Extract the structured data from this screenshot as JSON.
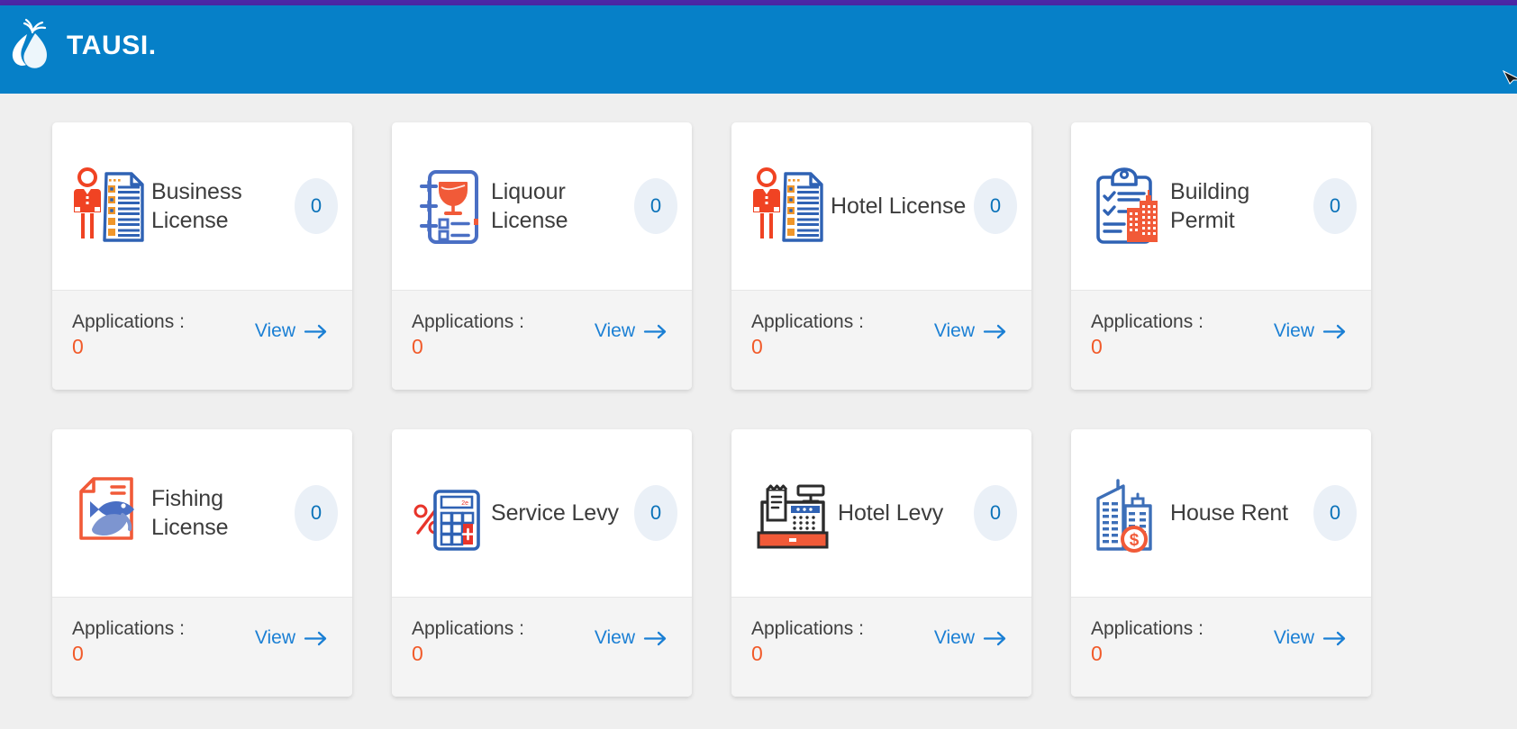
{
  "theme": {
    "accent_strip_color": "#4c27a6",
    "header_color": "#0680c8",
    "page_background": "#efefef",
    "card_background": "#ffffff",
    "card_footer_background": "#f4f4f4",
    "link_color": "#1a7fd4",
    "count_text_color": "#0a72b9",
    "count_badge_background": "#eaf0f7",
    "applications_value_color": "#f15a29",
    "title_color": "#3c3c3c",
    "icon_blue": "#3d6fb8",
    "icon_orange": "#f15a29",
    "icon_amber": "#f0962a"
  },
  "header": {
    "brand_name": "TAUSI.",
    "logo_icon": "tausi-droplet-logo"
  },
  "cards": [
    {
      "title": "Business License",
      "icon": "business-license-icon",
      "count": "0",
      "applications_label": "Applications :",
      "applications_value": "0",
      "view_label": "View",
      "view_icon": "arrow-right-icon"
    },
    {
      "title": "Liquour License",
      "icon": "liquour-license-icon",
      "count": "0",
      "applications_label": "Applications :",
      "applications_value": "0",
      "view_label": "View",
      "view_icon": "arrow-right-icon"
    },
    {
      "title": "Hotel License",
      "icon": "hotel-license-icon",
      "count": "0",
      "applications_label": "Applications :",
      "applications_value": "0",
      "view_label": "View",
      "view_icon": "arrow-right-icon"
    },
    {
      "title": "Building Permit",
      "icon": "building-permit-icon",
      "count": "0",
      "applications_label": "Applications :",
      "applications_value": "0",
      "view_label": "View",
      "view_icon": "arrow-right-icon"
    },
    {
      "title": "Fishing License",
      "icon": "fishing-license-icon",
      "count": "0",
      "applications_label": "Applications :",
      "applications_value": "0",
      "view_label": "View",
      "view_icon": "arrow-right-icon"
    },
    {
      "title": "Service Levy",
      "icon": "service-levy-icon",
      "count": "0",
      "applications_label": "Applications :",
      "applications_value": "0",
      "view_label": "View",
      "view_icon": "arrow-right-icon"
    },
    {
      "title": "Hotel Levy",
      "icon": "hotel-levy-icon",
      "count": "0",
      "applications_label": "Applications :",
      "applications_value": "0",
      "view_label": "View",
      "view_icon": "arrow-right-icon"
    },
    {
      "title": "House Rent",
      "icon": "house-rent-icon",
      "count": "0",
      "applications_label": "Applications :",
      "applications_value": "0",
      "view_label": "View",
      "view_icon": "arrow-right-icon"
    }
  ]
}
